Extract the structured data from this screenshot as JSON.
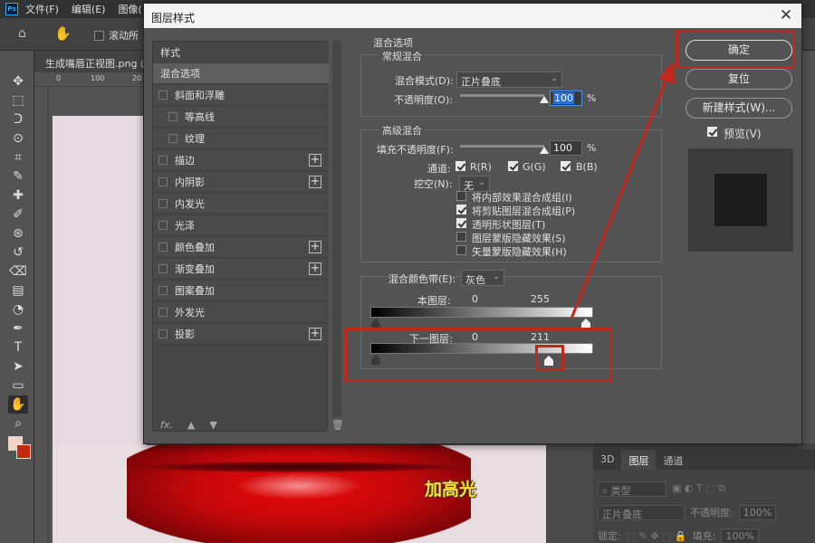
{
  "app": {
    "logo": "Ps",
    "menu": [
      "文件(F)",
      "编辑(E)",
      "图像("
    ],
    "options_bar": {
      "scroll_all_label": "滚动所"
    },
    "doc_tab": "生成嘴唇正视图.png @",
    "ruler_ticks": [
      "0",
      "100",
      "20"
    ],
    "toolbar_icons": [
      "move-icon",
      "marquee-icon",
      "lasso-icon",
      "quick-select-icon",
      "crop-icon",
      "eyedropper-icon",
      "healing-icon",
      "brush-icon",
      "clone-stamp-icon",
      "history-brush-icon",
      "eraser-icon",
      "gradient-icon",
      "dodge-icon",
      "pen-icon",
      "type-icon",
      "path-select-icon",
      "shape-icon",
      "hand-icon",
      "zoom-icon",
      "more-tools-icon"
    ],
    "foreground_color": "#f5d2c4",
    "background_color": "#c52a0e"
  },
  "canvas": {
    "caption": "加高光"
  },
  "layers_panel": {
    "tabs": [
      "3D",
      "图层",
      "通道"
    ],
    "active_tab": "图层",
    "filter_label": "类型",
    "blend_mode": "正片叠底",
    "opacity_label": "不透明度:",
    "opacity_value": "100%",
    "lock_label": "锁定:",
    "fill_label": "填充:",
    "fill_value": "100%"
  },
  "dialog": {
    "title": "图层样式",
    "styles_header": "样式",
    "styles": [
      {
        "label": "混合选项",
        "selected": true,
        "checkbox": false,
        "indent": false,
        "plus": false
      },
      {
        "label": "斜面和浮雕",
        "selected": false,
        "checkbox": true,
        "indent": false,
        "plus": false
      },
      {
        "label": "等高线",
        "selected": false,
        "checkbox": true,
        "indent": true,
        "plus": false
      },
      {
        "label": "纹理",
        "selected": false,
        "checkbox": true,
        "indent": true,
        "plus": false
      },
      {
        "label": "描边",
        "selected": false,
        "checkbox": true,
        "indent": false,
        "plus": true
      },
      {
        "label": "内阴影",
        "selected": false,
        "checkbox": true,
        "indent": false,
        "plus": true
      },
      {
        "label": "内发光",
        "selected": false,
        "checkbox": true,
        "indent": false,
        "plus": false
      },
      {
        "label": "光泽",
        "selected": false,
        "checkbox": true,
        "indent": false,
        "plus": false
      },
      {
        "label": "颜色叠加",
        "selected": false,
        "checkbox": true,
        "indent": false,
        "plus": true
      },
      {
        "label": "渐变叠加",
        "selected": false,
        "checkbox": true,
        "indent": false,
        "plus": true
      },
      {
        "label": "图案叠加",
        "selected": false,
        "checkbox": true,
        "indent": false,
        "plus": false
      },
      {
        "label": "外发光",
        "selected": false,
        "checkbox": true,
        "indent": false,
        "plus": false
      },
      {
        "label": "投影",
        "selected": false,
        "checkbox": true,
        "indent": false,
        "plus": true
      }
    ],
    "footer": {
      "fx": "fx."
    },
    "blending": {
      "section_title": "混合选项",
      "general": {
        "title": "常规混合",
        "blend_mode_label": "混合模式(D):",
        "blend_mode_value": "正片叠底",
        "opacity_label": "不透明度(O):",
        "opacity_value": "100",
        "opacity_slider": 1.0,
        "percent": "%"
      },
      "advanced": {
        "title": "高级混合",
        "fill_opacity_label": "填充不透明度(F):",
        "fill_opacity_value": "100",
        "fill_slider": 1.0,
        "percent": "%",
        "channels_label": "通道:",
        "channels": [
          {
            "label": "R(R)",
            "checked": true
          },
          {
            "label": "G(G)",
            "checked": true
          },
          {
            "label": "B(B)",
            "checked": true
          }
        ],
        "knockout_label": "挖空(N):",
        "knockout_value": "无",
        "options": [
          {
            "label": "将内部效果混合成组(I)",
            "checked": false
          },
          {
            "label": "将剪贴图层混合成组(P)",
            "checked": true
          },
          {
            "label": "透明形状图层(T)",
            "checked": true
          },
          {
            "label": "图层蒙版隐藏效果(S)",
            "checked": false
          },
          {
            "label": "矢量蒙版隐藏效果(H)",
            "checked": false
          }
        ]
      },
      "blend_if": {
        "label": "混合颜色带(E):",
        "value": "灰色",
        "this_layer": {
          "label": "本图层:",
          "low": "0",
          "high": "255"
        },
        "underlying": {
          "label": "下一图层:",
          "low": "0",
          "high": "211"
        }
      }
    },
    "buttons": {
      "ok": "确定",
      "reset": "复位",
      "new_style": "新建样式(W)...",
      "preview_label": "预览(V)",
      "preview_checked": true
    }
  },
  "annotation_color": "#c0281c"
}
